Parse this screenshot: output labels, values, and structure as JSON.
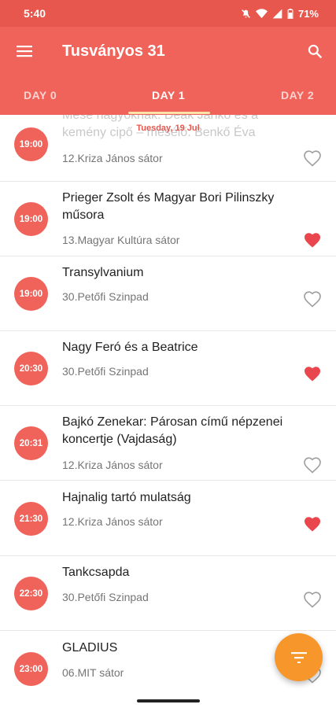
{
  "status_bar": {
    "time": "5:40",
    "battery": "71%"
  },
  "app_bar": {
    "title": "Tusványos 31"
  },
  "tabs": [
    {
      "label": "DAY 0"
    },
    {
      "label": "DAY 1"
    },
    {
      "label": "DAY 2"
    }
  ],
  "date_header": "Tuesday, 19 Jul",
  "events": [
    {
      "time": "19:00",
      "title": "Mese nagyoknak: Deák Jankó és a kemény cipő – mesélő: Benkő Éva",
      "venue": "12.Kriza János sátor",
      "favorite": false
    },
    {
      "time": "19:00",
      "title": "Prieger Zsolt és Magyar Bori Pilinszky műsora",
      "venue": "13.Magyar Kultúra sátor",
      "favorite": true
    },
    {
      "time": "19:00",
      "title": "Transylvanium",
      "venue": "30.Petőfi Szinpad",
      "favorite": false
    },
    {
      "time": "20:30",
      "title": "Nagy Feró és a Beatrice",
      "venue": "30.Petőfi Szinpad",
      "favorite": true
    },
    {
      "time": "20:31",
      "title": "Bajkó Zenekar: Párosan című népzenei koncertje (Vajdaság)",
      "venue": "12.Kriza János sátor",
      "favorite": false
    },
    {
      "time": "21:30",
      "title": "Hajnalig tartó mulatság",
      "venue": "12.Kriza János sátor",
      "favorite": true
    },
    {
      "time": "22:30",
      "title": "Tankcsapda",
      "venue": "30.Petőfi Szinpad",
      "favorite": false
    },
    {
      "time": "23:00",
      "title": "GLADIUS",
      "venue": "06.MIT sátor",
      "favorite": false
    }
  ],
  "colors": {
    "primary": "#f0635a",
    "status_bar": "#e8574d",
    "fab": "#f7962b",
    "heart": "#e9474d"
  },
  "icons": {
    "menu": "menu-icon",
    "search": "search-icon",
    "filter": "filter-icon",
    "heart": "heart-icon"
  }
}
